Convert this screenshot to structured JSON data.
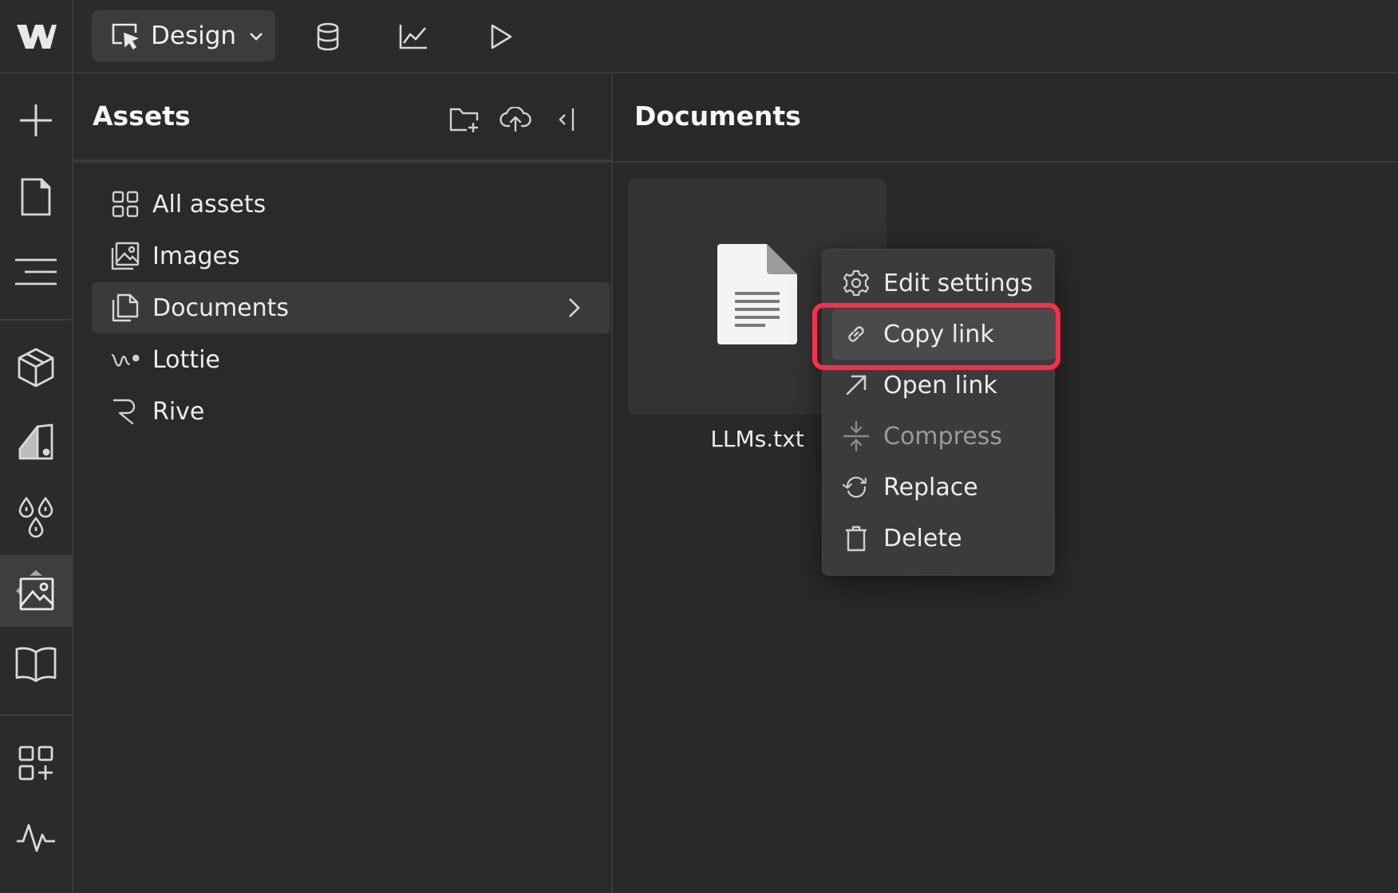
{
  "topbar": {
    "mode_label": "Design",
    "icons": [
      "webflow-logo-icon",
      "design-mode-icon",
      "chevron-down-icon",
      "database-icon",
      "analytics-icon",
      "preview-play-icon"
    ]
  },
  "rail": {
    "items": [
      "add-icon",
      "page-icon",
      "navigator-icon",
      "components-icon",
      "style-selectors-icon",
      "variables-icon",
      "assets-icon",
      "book-icon",
      "apps-icon",
      "activity-icon"
    ],
    "active": "assets-icon"
  },
  "assets": {
    "title": "Assets",
    "items": [
      {
        "label": "All assets",
        "icon": "grid-icon"
      },
      {
        "label": "Images",
        "icon": "image-icon"
      },
      {
        "label": "Documents",
        "icon": "documents-icon"
      },
      {
        "label": "Lottie",
        "icon": "lottie-icon"
      },
      {
        "label": "Rive",
        "icon": "rive-icon"
      }
    ],
    "selected": "Documents"
  },
  "documents": {
    "title": "Documents",
    "file_name": "LLMs.txt"
  },
  "context_menu": {
    "items": [
      {
        "label": "Edit settings",
        "icon": "gear-icon"
      },
      {
        "label": "Copy link",
        "icon": "link-icon"
      },
      {
        "label": "Open link",
        "icon": "arrow-up-right-icon"
      },
      {
        "label": "Compress",
        "icon": "compress-icon",
        "disabled": true
      },
      {
        "label": "Replace",
        "icon": "replace-icon"
      },
      {
        "label": "Delete",
        "icon": "trash-icon"
      }
    ],
    "highlighted": "Copy link",
    "highlight_color": "#ff2d4a"
  }
}
